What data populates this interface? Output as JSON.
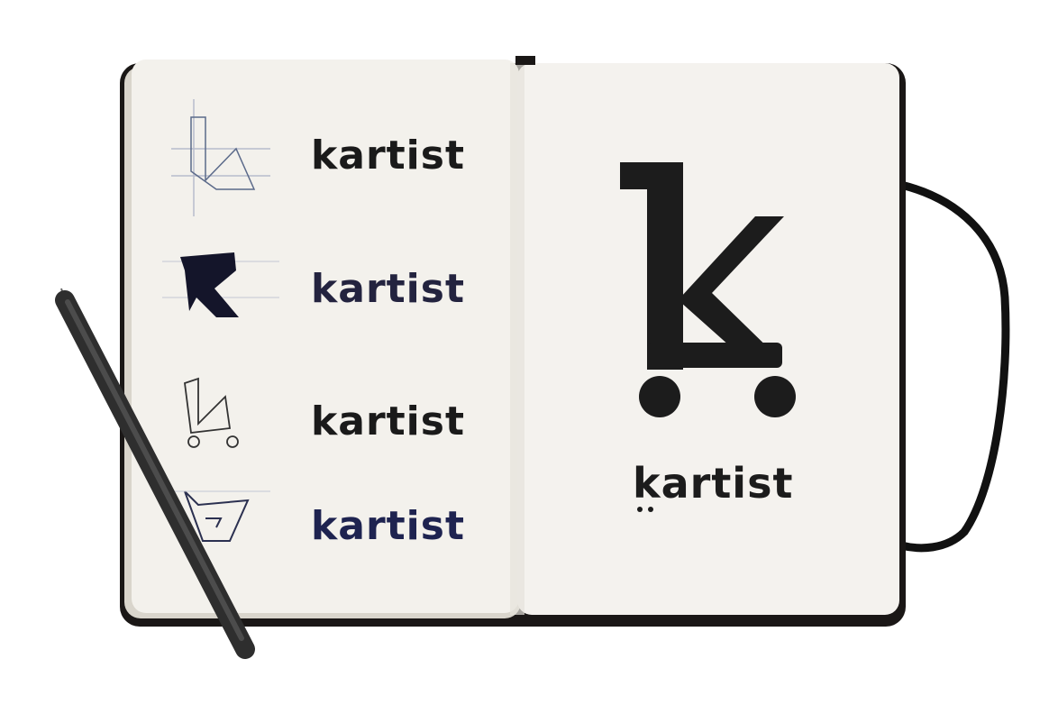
{
  "scene": {
    "left_page": {
      "sketches": [
        {
          "wordmark": "kartist",
          "color": "#1a1a1a"
        },
        {
          "wordmark": "kartist",
          "color": "#23233f"
        },
        {
          "wordmark": "kartist",
          "color": "#1a1a1a"
        },
        {
          "wordmark": "kartist",
          "color": "#1e2350"
        }
      ]
    },
    "right_page": {
      "final_logo": {
        "wordmark": "kartist",
        "color": "#1c1c1c"
      }
    },
    "colors": {
      "paper": "#f3f1ec",
      "cover": "#1a1716",
      "band": "#111111",
      "pen": "#3d3d3d"
    }
  }
}
